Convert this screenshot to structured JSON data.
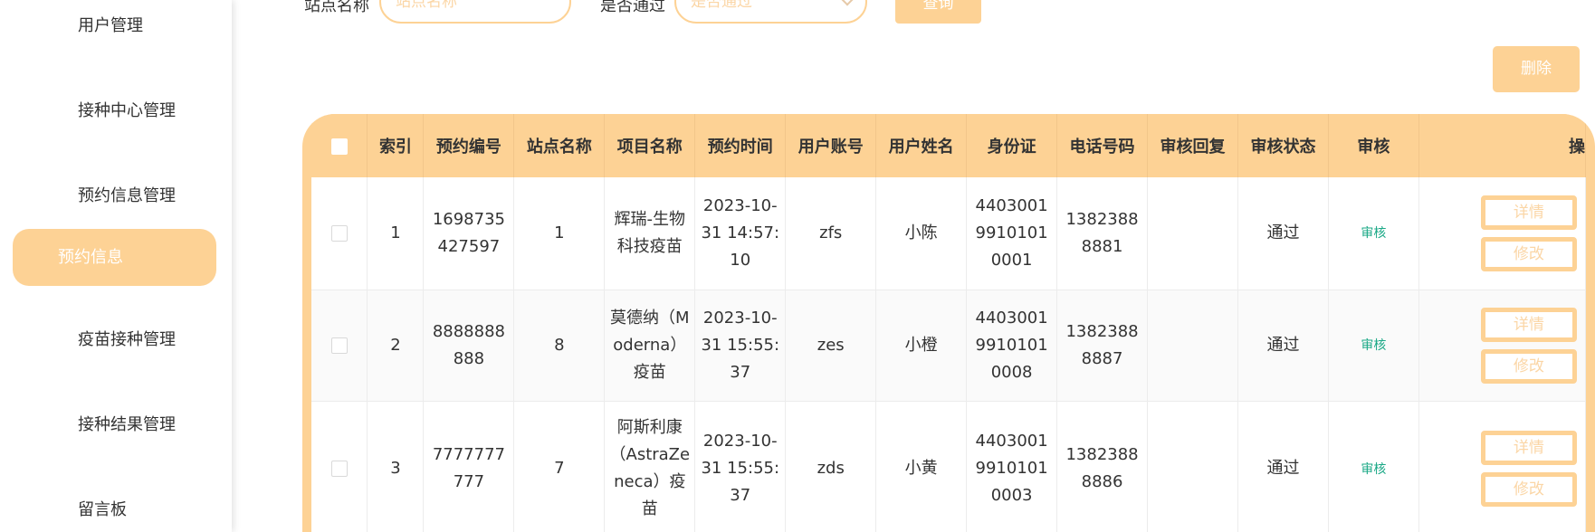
{
  "sidebar": {
    "items": [
      {
        "label": "用户管理"
      },
      {
        "label": "接种中心管理"
      },
      {
        "label": "预约信息管理"
      },
      {
        "label": "预约信息"
      },
      {
        "label": "疫苗接种管理"
      },
      {
        "label": "接种结果管理"
      },
      {
        "label": "留言板"
      }
    ]
  },
  "search": {
    "site_label": "站点名称",
    "site_placeholder": "站点名称",
    "pass_label": "是否通过",
    "pass_placeholder": "是否通过",
    "query_label": "查询"
  },
  "toolbar": {
    "delete_label": "删除"
  },
  "table": {
    "columns": [
      "索引",
      "预约编号",
      "站点名称",
      "项目名称",
      "预约时间",
      "用户账号",
      "用户姓名",
      "身份证",
      "电话号码",
      "审核回复",
      "审核状态",
      "审核",
      "操"
    ],
    "rows": [
      {
        "index": "1",
        "booking_no": "1698735427597",
        "site": "1",
        "project": "辉瑞-生物科技疫苗",
        "time": "2023-10-31 14:57:10",
        "account": "zfs",
        "name": "小陈",
        "id_card": "440300199101010001",
        "phone": "13823888881",
        "reply": "",
        "status": "通过",
        "audit": "审核",
        "detail_label": "详情",
        "edit_label": "修改"
      },
      {
        "index": "2",
        "booking_no": "8888888888",
        "site": "8",
        "project": "莫德纳（Moderna）疫苗",
        "time": "2023-10-31 15:55:37",
        "account": "zes",
        "name": "小橙",
        "id_card": "440300199101010008",
        "phone": "13823888887",
        "reply": "",
        "status": "通过",
        "audit": "审核",
        "detail_label": "详情",
        "edit_label": "修改"
      },
      {
        "index": "3",
        "booking_no": "7777777777",
        "site": "7",
        "project": "阿斯利康（AstraZeneca）疫苗",
        "time": "2023-10-31 15:55:37",
        "account": "zds",
        "name": "小黄",
        "id_card": "440300199101010003",
        "phone": "13823888886",
        "reply": "",
        "status": "通过",
        "audit": "审核",
        "detail_label": "详情",
        "edit_label": "修改"
      }
    ]
  }
}
